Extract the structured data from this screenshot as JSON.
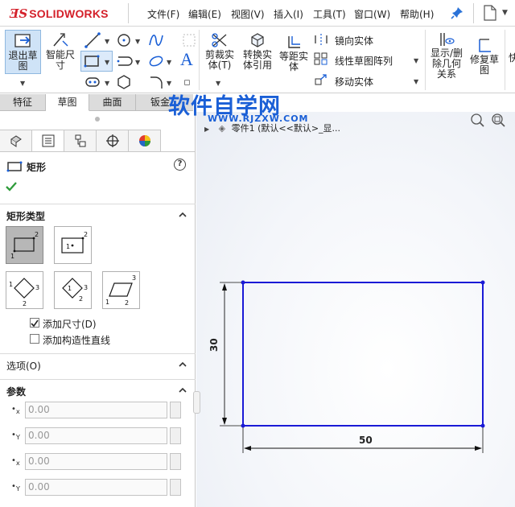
{
  "app": {
    "logo_text": "SOLIDWORKS",
    "menu": [
      "文件(F)",
      "编辑(E)",
      "视图(V)",
      "插入(I)",
      "工具(T)",
      "窗口(W)",
      "帮助(H)"
    ]
  },
  "toolbar": {
    "exit_sketch": "退出草图",
    "smart_dimension": "智能尺寸",
    "trim": "剪裁实体(T)",
    "convert": "转换实体引用",
    "offset": "等距实体",
    "mirror": "镜向实体",
    "linear_pattern": "线性草图阵列",
    "move": "移动实体",
    "display_relations": "显示/删除几何关系",
    "repair": "修复草图",
    "quick": "快"
  },
  "tabs": [
    "特征",
    "草图",
    "曲面",
    "钣金"
  ],
  "active_tab": "草图",
  "watermark": {
    "title": "软件自学网",
    "url": "WWW.RJZXW.COM"
  },
  "feature_tree": {
    "node": "零件1 (默认<<默认>_显..."
  },
  "property_manager": {
    "title": "矩形",
    "rect_type_header": "矩形类型",
    "add_dimensions": "添加尺寸(D)",
    "add_dimensions_checked": true,
    "add_construction": "添加构造性直线",
    "add_construction_checked": false,
    "options_header": "选项(O)",
    "params_header": "参数",
    "params": [
      "0.00",
      "0.00",
      "0.00",
      "0.00"
    ]
  },
  "sketch": {
    "width_dim": "50",
    "height_dim": "30",
    "line_color": "#1a1ad6"
  },
  "colors": {
    "accent": "#1a5fd6",
    "logo": "#d4202a"
  }
}
